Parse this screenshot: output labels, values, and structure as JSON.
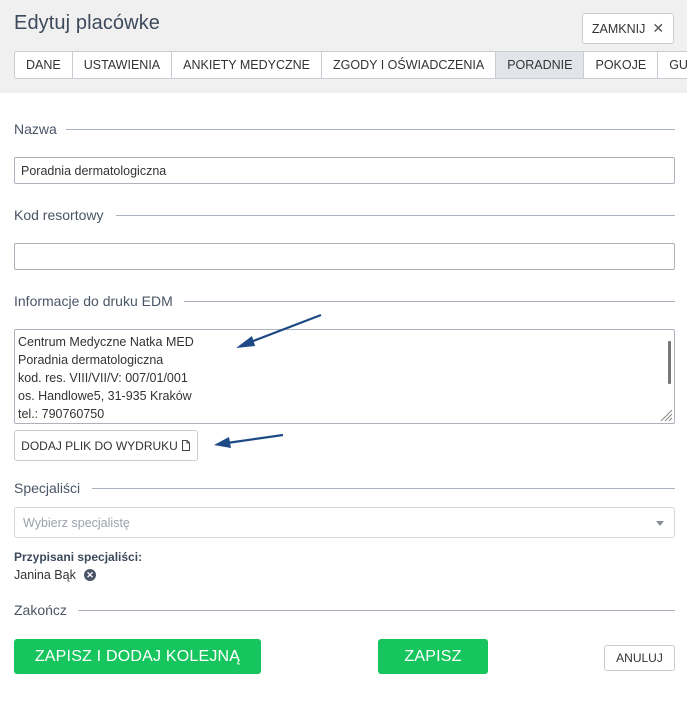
{
  "header": {
    "title": "Edytuj placówke",
    "close_label": "ZAMKNIJ",
    "close_glyph": "✕"
  },
  "tabs": [
    {
      "label": "DANE"
    },
    {
      "label": "USTAWIENIA"
    },
    {
      "label": "ANKIETY MEDYCZNE"
    },
    {
      "label": "ZGODY I OŚWIADCZENIA"
    },
    {
      "label": "PORADNIE",
      "active": true
    },
    {
      "label": "POKOJE"
    },
    {
      "label": "GUS"
    }
  ],
  "form": {
    "name_label": "Nazwa",
    "name_value": "Poradnia dermatologiczna",
    "code_label": "Kod resortowy",
    "code_value": "",
    "edm_label": "Informacje do druku EDM",
    "edm_lines": [
      "Centrum Medyczne Natka MED",
      "Poradnia dermatologiczna",
      "kod. res. VIII/VII/V: 007/01/001",
      "os. Handlowe5, 31-935 Kraków",
      "tel.: 790760750"
    ],
    "add_file_label": "DODAJ PLIK DO WYDRUKU",
    "specialists_label": "Specjaliści",
    "specialists_placeholder": "Wybierz specjalistę",
    "assigned_label": "Przypisani specjaliści:",
    "assigned": [
      "Janina Bąk"
    ],
    "finish_label": "Zakończ"
  },
  "actions": {
    "save_and_add_label": "ZAPISZ I DODAJ KOLEJNĄ",
    "save_label": "ZAPISZ",
    "cancel_label": "ANULUJ"
  },
  "colors": {
    "primary_green": "#17c55e",
    "arrow_blue": "#1d4a85"
  }
}
